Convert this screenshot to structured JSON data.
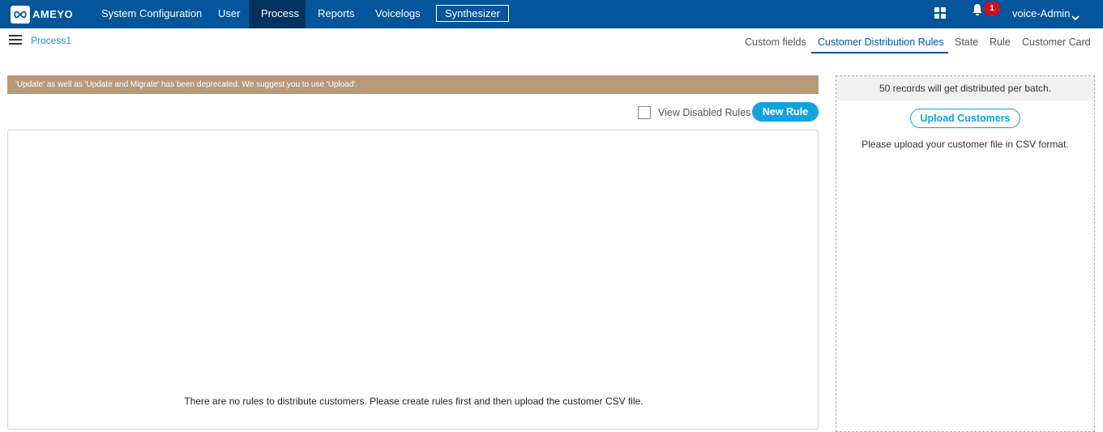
{
  "topbar": {
    "logo_text": "AMEYO",
    "nav": [
      {
        "label": "System Configuration",
        "active": false
      },
      {
        "label": "User",
        "active": false
      },
      {
        "label": "Process",
        "active": true
      },
      {
        "label": "Reports",
        "active": false
      },
      {
        "label": "Voicelogs",
        "active": false
      }
    ],
    "synthesizer_label": "Synthesizer",
    "notification_count": "1",
    "user_name": "voice-Admin",
    "icons": [
      "apps-grid-icon",
      "bell-icon",
      "chevron-down-icon"
    ]
  },
  "breadcrumb": {
    "process": "Process1"
  },
  "tabs": [
    {
      "label": "Custom fields",
      "active": false
    },
    {
      "label": "Customer Distribution Rules",
      "active": true
    },
    {
      "label": "State",
      "active": false
    },
    {
      "label": "Rule",
      "active": false
    },
    {
      "label": "Customer Card",
      "active": false
    }
  ],
  "notice": "'Update' as well as 'Update and Migrate' has been deprecated. We suggest you to use 'Upload'.",
  "rules": {
    "view_disabled_label": "View Disabled Rules",
    "view_disabled_checked": false,
    "new_rule_label": "New Rule",
    "empty_message": "There are no rules to distribute customers. Please create rules first and then upload the customer CSV file."
  },
  "upload_panel": {
    "batch_info": "50 records will get distributed per batch.",
    "upload_label": "Upload Customers",
    "hint": "Please upload your customer file in CSV format."
  },
  "colors": {
    "header": "#03559c",
    "active_nav": "#02335e",
    "accent": "#12a3df",
    "notice": "#b89a79",
    "badge": "#d0121b"
  }
}
